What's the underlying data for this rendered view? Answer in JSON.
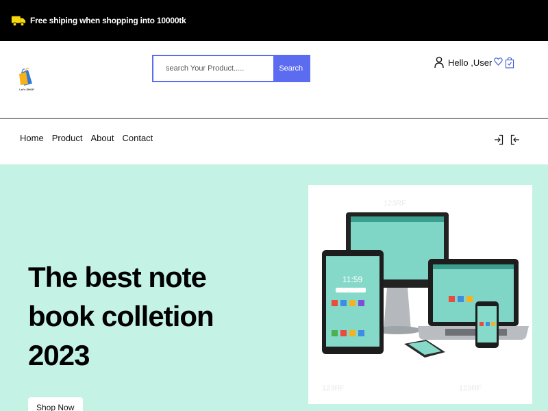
{
  "topbar": {
    "promo": "Free shiping when shopping into 10000tk",
    "icon": "truck-icon",
    "icon_color": "#f5d90a"
  },
  "header": {
    "logo_text": "Let's SHOP",
    "search": {
      "placeholder": "search Your Product.....",
      "button_label": "Search"
    },
    "user_greeting": "Hello ,User",
    "icons": [
      "user-icon",
      "heart-icon",
      "shopping-bag-icon"
    ]
  },
  "nav": {
    "items": [
      {
        "label": "Home"
      },
      {
        "label": "Product"
      },
      {
        "label": "About"
      },
      {
        "label": "Contact"
      }
    ],
    "icons": [
      "login-icon",
      "logout-icon"
    ]
  },
  "hero": {
    "title": "The best note book colletion 2023",
    "button_label": "Shop Now",
    "image_alt": "laptop, monitor, tablet and smartphone"
  },
  "colors": {
    "topbar_bg": "#000000",
    "accent": "#5b6cf0",
    "hero_bg": "#c4f3e6",
    "icon_blue": "#3a56c8"
  }
}
